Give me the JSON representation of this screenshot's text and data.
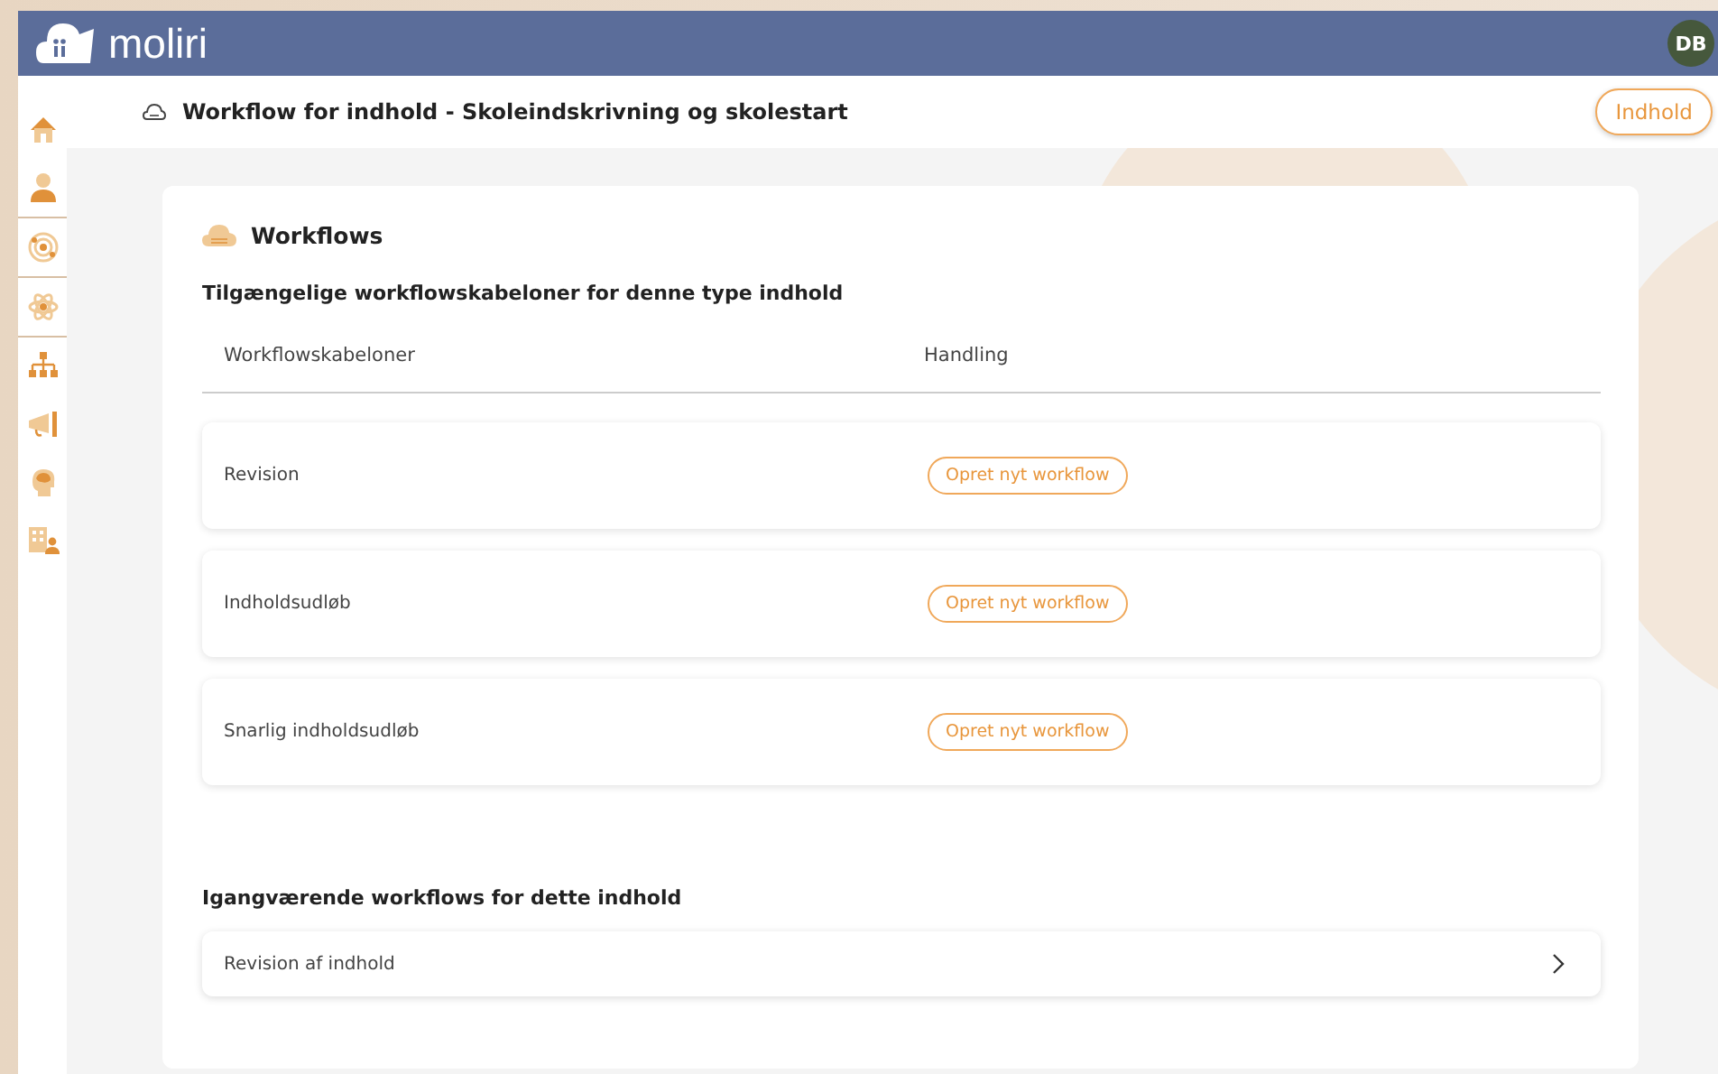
{
  "app_bar": {
    "logo_text": "moliri",
    "avatar_initials": "DB"
  },
  "page_header": {
    "title": "Workflow for indhold - Skoleindskrivning og skolestart",
    "button": "Indhold"
  },
  "card": {
    "title": "Workflows",
    "templates_heading": "Tilgængelige workflowskabeloner for denne type indhold",
    "table": {
      "columns": [
        "Workflowskabeloner",
        "Handling"
      ],
      "rows": [
        {
          "name": "Revision",
          "action": "Opret nyt workflow"
        },
        {
          "name": "Indholdsudløb",
          "action": "Opret nyt workflow"
        },
        {
          "name": "Snarlig indholdsudløb",
          "action": "Opret nyt workflow"
        }
      ]
    },
    "ongoing_heading": "Igangværende workflows for dette indhold",
    "ongoing": [
      {
        "name": "Revision af indhold"
      }
    ]
  }
}
